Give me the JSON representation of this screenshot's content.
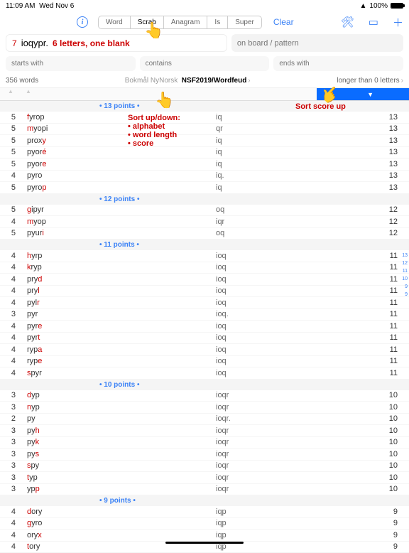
{
  "status": {
    "time": "11:09 AM",
    "date": "Wed Nov 6",
    "battery": "100%"
  },
  "seg": [
    "Word",
    "Scrab",
    "Anagram",
    "Is",
    "Super"
  ],
  "seg_active": 1,
  "clear": "Clear",
  "rack": {
    "count": "7",
    "letters": "ioqypr.",
    "hint": "6 letters, one blank"
  },
  "filters": {
    "board": "on board / pattern",
    "starts": "starts with",
    "contains": "contains",
    "ends": "ends with"
  },
  "meta": {
    "count": "356 words",
    "langs": "Bokmål  NyNorsk",
    "dict": "NSF2019/Wordfeud",
    "filter": "longer than 0 letters"
  },
  "call": {
    "sort": "Sort up/down:\n• alphabet\n• word length\n• score",
    "scoreup": "Sort score up"
  },
  "side": [
    "13",
    "12",
    "11",
    "10",
    "9",
    "9"
  ],
  "groups": [
    {
      "pts": "• 13 points •",
      "rows": [
        {
          "len": "5",
          "w": [
            [
              "f",
              "r"
            ],
            [
              "yrop",
              ""
            ]
          ],
          "mid": "iq",
          "sc": "13"
        },
        {
          "len": "5",
          "w": [
            [
              "m",
              "r"
            ],
            [
              "yopi",
              ""
            ]
          ],
          "mid": "qr",
          "sc": "13"
        },
        {
          "len": "5",
          "w": [
            [
              "prox",
              ""
            ],
            [
              "y",
              "r"
            ]
          ],
          "mid": "iq",
          "sc": "13"
        },
        {
          "len": "5",
          "w": [
            [
              "pyor",
              ""
            ],
            [
              "é",
              "r"
            ]
          ],
          "mid": "iq",
          "sc": "13"
        },
        {
          "len": "5",
          "w": [
            [
              "pyor",
              ""
            ],
            [
              "e",
              "r"
            ]
          ],
          "mid": "iq",
          "sc": "13"
        },
        {
          "len": "4",
          "w": [
            [
              "pyro",
              ""
            ]
          ],
          "mid": "iq.",
          "sc": "13"
        },
        {
          "len": "5",
          "w": [
            [
              "pyro",
              ""
            ],
            [
              "p",
              "r"
            ]
          ],
          "mid": "iq",
          "sc": "13"
        }
      ]
    },
    {
      "pts": "• 12 points •",
      "rows": [
        {
          "len": "5",
          "w": [
            [
              "g",
              "r"
            ],
            [
              "ipyr",
              ""
            ]
          ],
          "mid": "oq",
          "sc": "12"
        },
        {
          "len": "4",
          "w": [
            [
              "m",
              "r"
            ],
            [
              "yop",
              ""
            ]
          ],
          "mid": "iqr",
          "sc": "12"
        },
        {
          "len": "5",
          "w": [
            [
              "pyur",
              ""
            ],
            [
              "i",
              "r"
            ]
          ],
          "mid": "oq",
          "sc": "12"
        }
      ]
    },
    {
      "pts": "• 11 points •",
      "rows": [
        {
          "len": "4",
          "w": [
            [
              "h",
              "r"
            ],
            [
              "yrp",
              ""
            ]
          ],
          "mid": "ioq",
          "sc": "11"
        },
        {
          "len": "4",
          "w": [
            [
              "k",
              "r"
            ],
            [
              "ryp",
              ""
            ]
          ],
          "mid": "ioq",
          "sc": "11"
        },
        {
          "len": "4",
          "w": [
            [
              "pry",
              ""
            ],
            [
              "d",
              "r"
            ]
          ],
          "mid": "ioq",
          "sc": "11"
        },
        {
          "len": "4",
          "w": [
            [
              "pry",
              ""
            ],
            [
              "l",
              "r"
            ]
          ],
          "mid": "ioq",
          "sc": "11"
        },
        {
          "len": "4",
          "w": [
            [
              "pyl",
              ""
            ],
            [
              "r",
              "r"
            ]
          ],
          "mid": "ioq",
          "sc": "11"
        },
        {
          "len": "3",
          "w": [
            [
              "pyr",
              ""
            ]
          ],
          "mid": "ioq.",
          "sc": "11"
        },
        {
          "len": "4",
          "w": [
            [
              "pyr",
              ""
            ],
            [
              "e",
              "r"
            ]
          ],
          "mid": "ioq",
          "sc": "11"
        },
        {
          "len": "4",
          "w": [
            [
              "pyr",
              ""
            ],
            [
              "t",
              "r"
            ]
          ],
          "mid": "ioq",
          "sc": "11"
        },
        {
          "len": "4",
          "w": [
            [
              "ryp",
              ""
            ],
            [
              "a",
              "r"
            ]
          ],
          "mid": "ioq",
          "sc": "11"
        },
        {
          "len": "4",
          "w": [
            [
              "ryp",
              ""
            ],
            [
              "e",
              "r"
            ]
          ],
          "mid": "ioq",
          "sc": "11"
        },
        {
          "len": "4",
          "w": [
            [
              "s",
              "r"
            ],
            [
              "pyr",
              ""
            ]
          ],
          "mid": "ioq",
          "sc": "11"
        }
      ]
    },
    {
      "pts": "• 10 points •",
      "rows": [
        {
          "len": "3",
          "w": [
            [
              "d",
              "r"
            ],
            [
              "yp",
              ""
            ]
          ],
          "mid": "ioqr",
          "sc": "10"
        },
        {
          "len": "3",
          "w": [
            [
              "n",
              "r"
            ],
            [
              "yp",
              ""
            ]
          ],
          "mid": "ioqr",
          "sc": "10"
        },
        {
          "len": "2",
          "w": [
            [
              "py",
              ""
            ]
          ],
          "mid": "ioqr.",
          "sc": "10"
        },
        {
          "len": "3",
          "w": [
            [
              "py",
              ""
            ],
            [
              "h",
              "r"
            ]
          ],
          "mid": "ioqr",
          "sc": "10"
        },
        {
          "len": "3",
          "w": [
            [
              "py",
              ""
            ],
            [
              "k",
              "r"
            ]
          ],
          "mid": "ioqr",
          "sc": "10"
        },
        {
          "len": "3",
          "w": [
            [
              "py",
              ""
            ],
            [
              "s",
              "r"
            ]
          ],
          "mid": "ioqr",
          "sc": "10"
        },
        {
          "len": "3",
          "w": [
            [
              "s",
              "r"
            ],
            [
              "py",
              ""
            ]
          ],
          "mid": "ioqr",
          "sc": "10"
        },
        {
          "len": "3",
          "w": [
            [
              "t",
              "r"
            ],
            [
              "yp",
              ""
            ]
          ],
          "mid": "ioqr",
          "sc": "10"
        },
        {
          "len": "3",
          "w": [
            [
              "yp",
              ""
            ],
            [
              "p",
              "r"
            ]
          ],
          "mid": "ioqr",
          "sc": "10"
        }
      ]
    },
    {
      "pts": "• 9 points •",
      "rows": [
        {
          "len": "4",
          "w": [
            [
              "d",
              "r"
            ],
            [
              "ory",
              ""
            ]
          ],
          "mid": "iqp",
          "sc": "9"
        },
        {
          "len": "4",
          "w": [
            [
              "g",
              "r"
            ],
            [
              "yro",
              ""
            ]
          ],
          "mid": "iqp",
          "sc": "9"
        },
        {
          "len": "4",
          "w": [
            [
              "ory",
              ""
            ],
            [
              "x",
              "r"
            ]
          ],
          "mid": "iqp",
          "sc": "9"
        },
        {
          "len": "4",
          "w": [
            [
              "t",
              "r"
            ],
            [
              "ory",
              ""
            ]
          ],
          "mid": "iqp",
          "sc": "9"
        }
      ]
    }
  ]
}
